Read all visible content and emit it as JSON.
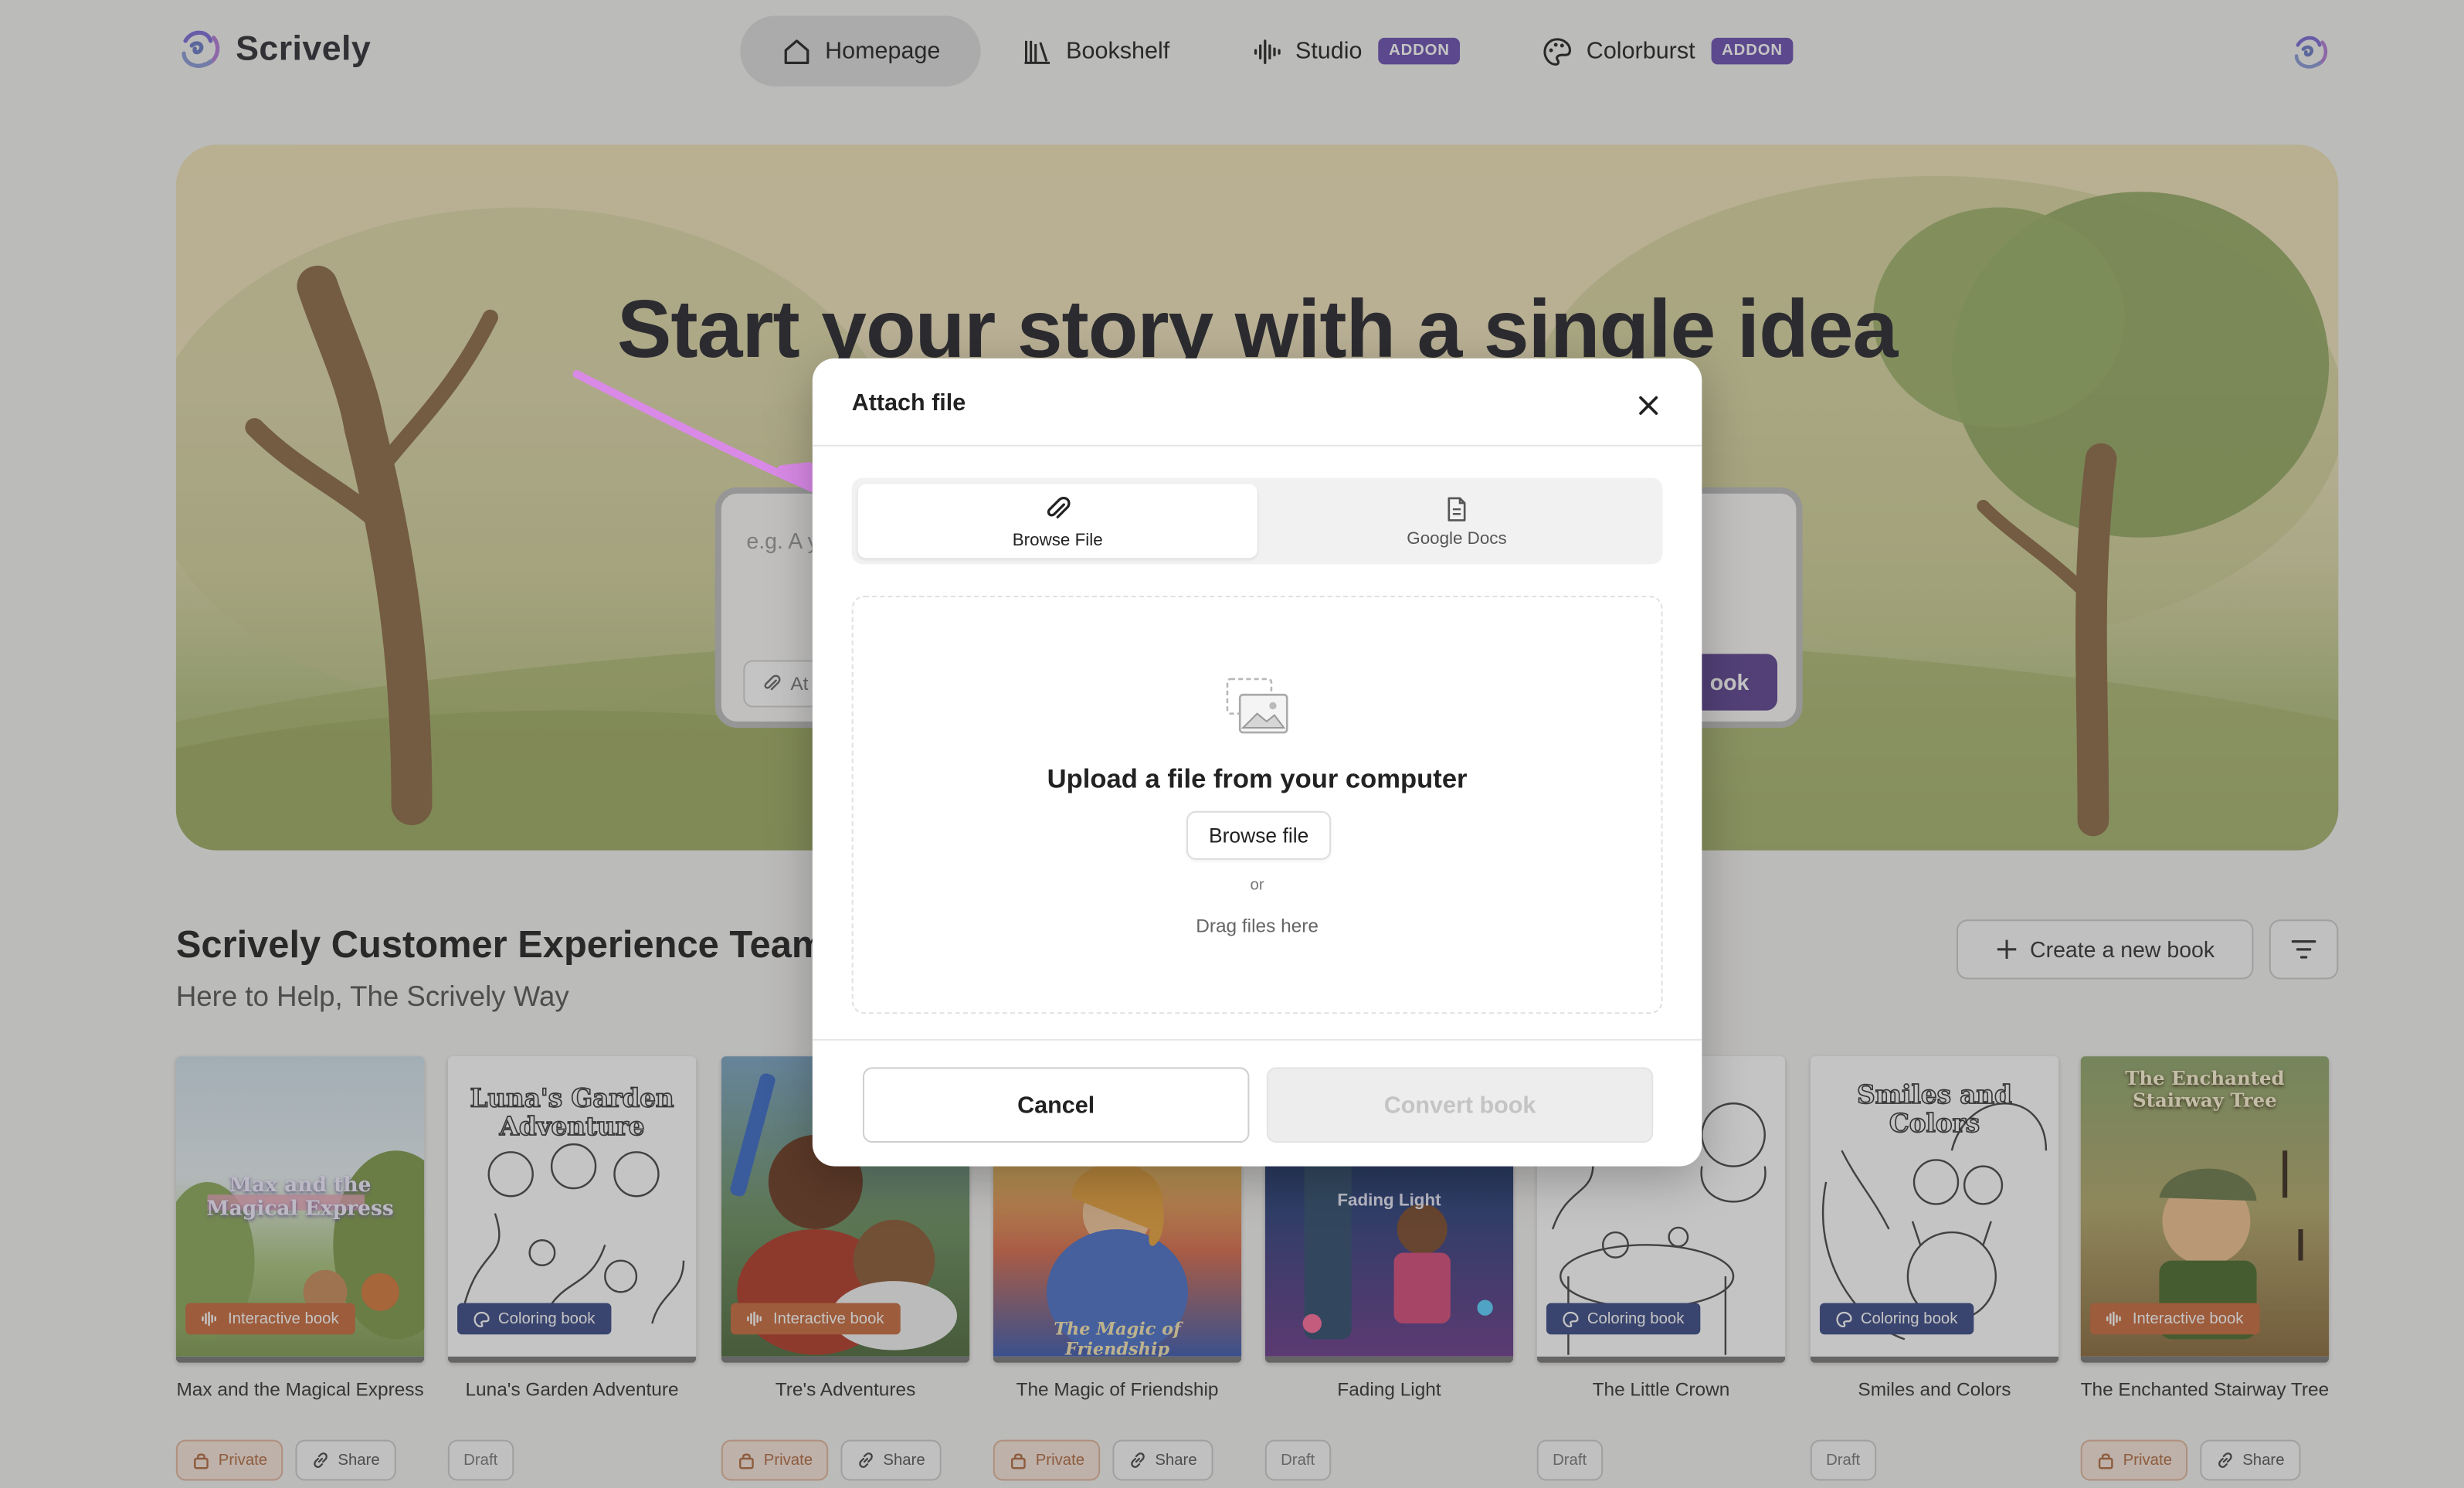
{
  "app": {
    "name": "Scrively"
  },
  "nav": {
    "items": [
      {
        "label": "Homepage",
        "icon": "home-icon",
        "active": true
      },
      {
        "label": "Bookshelf",
        "icon": "bookshelf-icon"
      },
      {
        "label": "Studio",
        "icon": "audio-wave-icon",
        "badge": "ADDON"
      },
      {
        "label": "Colorburst",
        "icon": "palette-icon",
        "badge": "ADDON"
      }
    ]
  },
  "hero": {
    "title": "Start your story with a single idea",
    "prompt_placeholder": "e.g. A y",
    "attach_label": "At",
    "create_label": "ook"
  },
  "team": {
    "title": "Scrively Customer Experience Team",
    "subtitle": "Here to Help, The Scrively Way",
    "create_button": "Create a new book"
  },
  "books": [
    {
      "title": "Max and the Magical Express",
      "cover_text": "Max and the Magical Express",
      "badge": "Interactive book",
      "status": "Private",
      "share": "Share"
    },
    {
      "title": "Luna's Garden Adventure",
      "cover_text": "Luna's Garden Adventure",
      "badge": "Coloring book",
      "status": "Draft"
    },
    {
      "title": "Tre's Adventures",
      "cover_text": "",
      "badge": "Interactive book",
      "status": "Private",
      "share": "Share"
    },
    {
      "title": "The Magic of Friendship",
      "cover_text": "The Magic of Friendship",
      "badge": "",
      "status": "Private",
      "share": "Share"
    },
    {
      "title": "Fading Light",
      "cover_text": "Fading Light",
      "badge": "",
      "status": "Draft"
    },
    {
      "title": "The Little Crown",
      "cover_text": "",
      "badge": "Coloring book",
      "status": "Draft"
    },
    {
      "title": "Smiles and Colors",
      "cover_text": "Smiles and Colors",
      "badge": "Coloring book",
      "status": "Draft"
    },
    {
      "title": "The Enchanted Stairway Tree",
      "cover_text": "The Enchanted Stairway Tree",
      "badge": "Interactive book",
      "status": "Private",
      "share": "Share"
    }
  ],
  "modal": {
    "title": "Attach file",
    "tabs": [
      {
        "label": "Browse File",
        "icon": "paperclip-icon",
        "active": true
      },
      {
        "label": "Google Docs",
        "icon": "document-icon"
      }
    ],
    "drop_title": "Upload a file from your computer",
    "browse_button": "Browse file",
    "or_text": "or",
    "drag_text": "Drag files here",
    "cancel_button": "Cancel",
    "convert_button": "Convert book"
  },
  "colors": {
    "accent": "#6b4fb0",
    "interactive_badge": "#c86a3c",
    "coloring_badge": "#3a4a86",
    "arrow": "#d98ae6"
  }
}
